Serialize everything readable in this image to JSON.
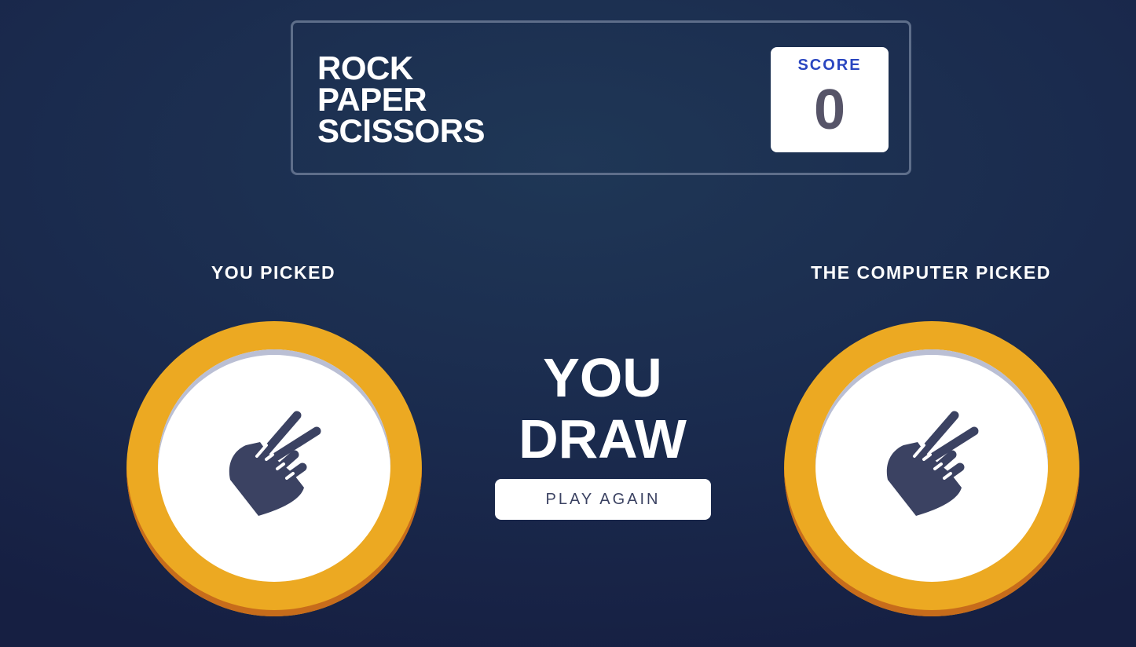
{
  "header": {
    "title_lines": [
      "ROCK",
      "PAPER",
      "SCISSORS"
    ],
    "score_label": "SCORE",
    "score_value": "0"
  },
  "game": {
    "you_picked_label": "YOU PICKED",
    "computer_picked_label": "THE COMPUTER PICKED",
    "you_choice_icon": "scissors-icon",
    "computer_choice_icon": "scissors-icon",
    "result_lines": [
      "YOU",
      "DRAW"
    ],
    "play_again_label": "PLAY AGAIN"
  },
  "colors": {
    "background": "#1f3756",
    "scissors_ring": "#eca922",
    "scissors_ring_shadow": "#c76c1b",
    "score_label": "#2a46c0",
    "score_value": "#565468",
    "icon": "#3b4262"
  }
}
